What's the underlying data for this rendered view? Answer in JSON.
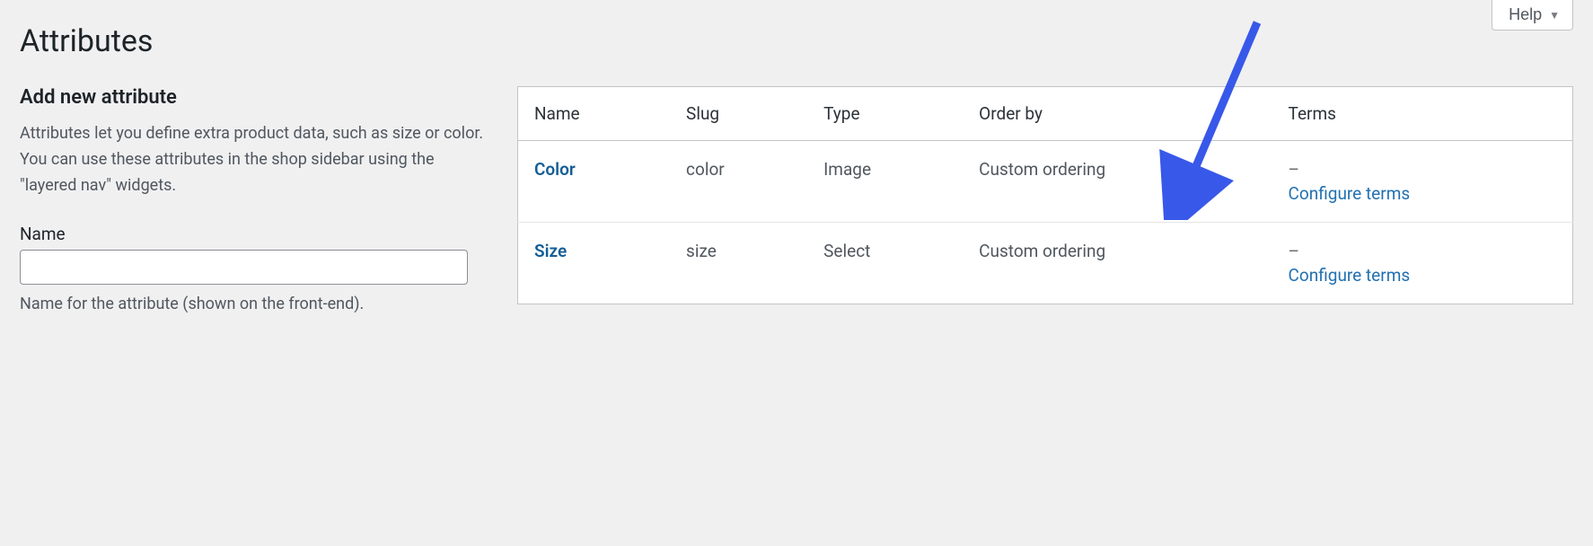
{
  "help_button": "Help",
  "page_title": "Attributes",
  "left": {
    "section_title": "Add new attribute",
    "description": "Attributes let you define extra product data, such as size or color. You can use these attributes in the shop sidebar using the \"layered nav\" widgets.",
    "name_label": "Name",
    "name_value": "",
    "name_hint": "Name for the attribute (shown on the front-end)."
  },
  "table": {
    "columns": {
      "name": "Name",
      "slug": "Slug",
      "type": "Type",
      "order_by": "Order by",
      "terms": "Terms"
    },
    "terms_placeholder": "–",
    "configure_label": "Configure terms",
    "rows": [
      {
        "name": "Color",
        "slug": "color",
        "type": "Image",
        "order_by": "Custom ordering"
      },
      {
        "name": "Size",
        "slug": "size",
        "type": "Select",
        "order_by": "Custom ordering"
      }
    ]
  }
}
